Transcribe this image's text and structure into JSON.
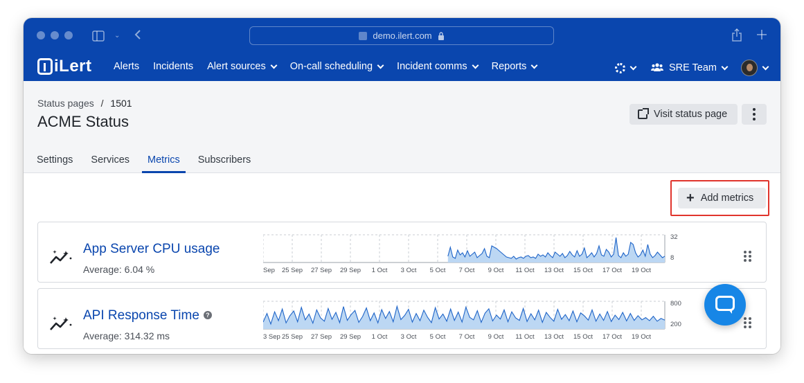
{
  "browser": {
    "url": "demo.ilert.com"
  },
  "nav": {
    "logo_text": "iLert",
    "links": [
      {
        "label": "Alerts",
        "dropdown": false
      },
      {
        "label": "Incidents",
        "dropdown": false
      },
      {
        "label": "Alert sources",
        "dropdown": true
      },
      {
        "label": "On-call scheduling",
        "dropdown": true
      },
      {
        "label": "Incident comms",
        "dropdown": true
      },
      {
        "label": "Reports",
        "dropdown": true
      }
    ],
    "team_label": "SRE Team"
  },
  "page": {
    "breadcrumb_parent": "Status pages",
    "breadcrumb_sep": "/",
    "breadcrumb_current": "1501",
    "title": "ACME Status",
    "visit_button": "Visit status page",
    "tabs": [
      {
        "label": "Settings",
        "active": false
      },
      {
        "label": "Services",
        "active": false
      },
      {
        "label": "Metrics",
        "active": true
      },
      {
        "label": "Subscribers",
        "active": false
      }
    ],
    "add_metrics_label": "Add metrics"
  },
  "metrics": [
    {
      "title": "App Server CPU usage",
      "average": "Average: 6.04 %",
      "has_help": false,
      "chart": {
        "type": "area",
        "x_ticks": [
          "Sep",
          "25 Sep",
          "27 Sep",
          "29 Sep",
          "1 Oct",
          "3 Oct",
          "5 Oct",
          "7 Oct",
          "9 Oct",
          "11 Oct",
          "13 Oct",
          "15 Oct",
          "17 Oct",
          "19 Oct"
        ],
        "y_ticks": [
          "32",
          "8"
        ],
        "ylim": [
          0,
          40
        ],
        "data_start_fraction": 0.46,
        "values": [
          9,
          22,
          8,
          6,
          18,
          11,
          14,
          8,
          17,
          9,
          12,
          15,
          7,
          10,
          13,
          20,
          9,
          7,
          24,
          22,
          20,
          17,
          14,
          11,
          8,
          7,
          6,
          9,
          5,
          7,
          8,
          6,
          9,
          10,
          7,
          8,
          6,
          12,
          9,
          11,
          8,
          14,
          10,
          7,
          15,
          12,
          9,
          13,
          7,
          10,
          16,
          11,
          8,
          17,
          9,
          12,
          21,
          7,
          10,
          14,
          8,
          13,
          24,
          11,
          9,
          19,
          15,
          8,
          12,
          36,
          10,
          7,
          14,
          9,
          12,
          29,
          26,
          14,
          8,
          11,
          18,
          9,
          26,
          12,
          7,
          10,
          15,
          11,
          7,
          9
        ]
      }
    },
    {
      "title": "API Response Time",
      "average": "Average: 314.32 ms",
      "has_help": true,
      "chart": {
        "type": "area",
        "x_ticks": [
          "3 Sep",
          "25 Sep",
          "27 Sep",
          "29 Sep",
          "1 Oct",
          "3 Oct",
          "5 Oct",
          "7 Oct",
          "9 Oct",
          "11 Oct",
          "13 Oct",
          "15 Oct",
          "17 Oct",
          "19 Oct"
        ],
        "y_ticks": [
          "800",
          "200"
        ],
        "ylim": [
          0,
          1000
        ],
        "data_start_fraction": 0,
        "values": [
          250,
          560,
          180,
          620,
          300,
          720,
          220,
          480,
          650,
          260,
          780,
          330,
          540,
          210,
          690,
          400,
          280,
          740,
          350,
          600,
          230,
          810,
          310,
          520,
          670,
          240,
          450,
          760,
          300,
          580,
          220,
          700,
          380,
          630,
          260,
          820,
          340,
          490,
          710,
          250,
          560,
          300,
          680,
          420,
          230,
          770,
          360,
          540,
          280,
          720,
          310,
          610,
          250,
          790,
          420,
          330,
          660,
          240,
          570,
          730,
          290,
          500,
          360,
          690,
          260,
          620,
          400,
          310,
          740,
          270,
          550,
          330,
          680,
          240,
          600,
          420,
          280,
          710,
          350,
          520,
          300,
          650,
          260,
          580,
          470,
          320,
          690,
          280,
          540,
          310,
          630,
          270,
          500,
          340,
          600,
          290,
          560,
          310,
          480,
          330,
          410,
          300,
          460,
          280,
          380,
          320
        ]
      }
    }
  ]
}
